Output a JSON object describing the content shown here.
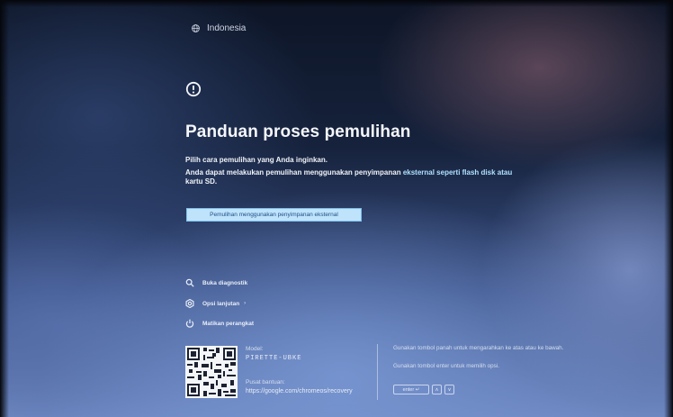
{
  "header": {
    "language": "Indonesia",
    "language_icon": "globe-icon"
  },
  "main": {
    "alert_icon": "alert-circle-icon",
    "title": "Panduan proses pemulihan",
    "subtitle": "Pilih cara pemulihan yang Anda inginkan.",
    "description_part1": "Anda dapat melakukan pemulihan menggunakan penyimpanan ",
    "description_highlight": "eksternal seperti flash disk atau",
    "description_part2": "kartu SD.",
    "external_storage_button": "Pemulihan menggunakan penyimpanan eksternal"
  },
  "menu": {
    "items": [
      {
        "label": "Buka diagnostik",
        "icon": "search-icon"
      },
      {
        "label": "Opsi lanjutan",
        "icon": "settings-icon",
        "chevron": "›"
      },
      {
        "label": "Matikan perangkat",
        "icon": "power-icon"
      }
    ]
  },
  "footer": {
    "qr_icon": "qr-code-icon",
    "model_label": "Model:",
    "model_value": "PIRETTE-UBKE",
    "help_label": "Pusat bantuan:",
    "help_url": "https://google.com/chromeos/recovery",
    "nav_hint": "Gunakan tombol panah untuk mengarahkan ke atas atau ke bawah.",
    "enter_hint": "Gunakan tombol enter untuk memilih opsi.",
    "keys": {
      "enter": "enter ↵",
      "up": "∧",
      "down": "∨"
    }
  },
  "colors": {
    "button_bg": "#bfe3fb",
    "button_text": "#1c4f86",
    "highlight_text": "#aee0ff"
  }
}
